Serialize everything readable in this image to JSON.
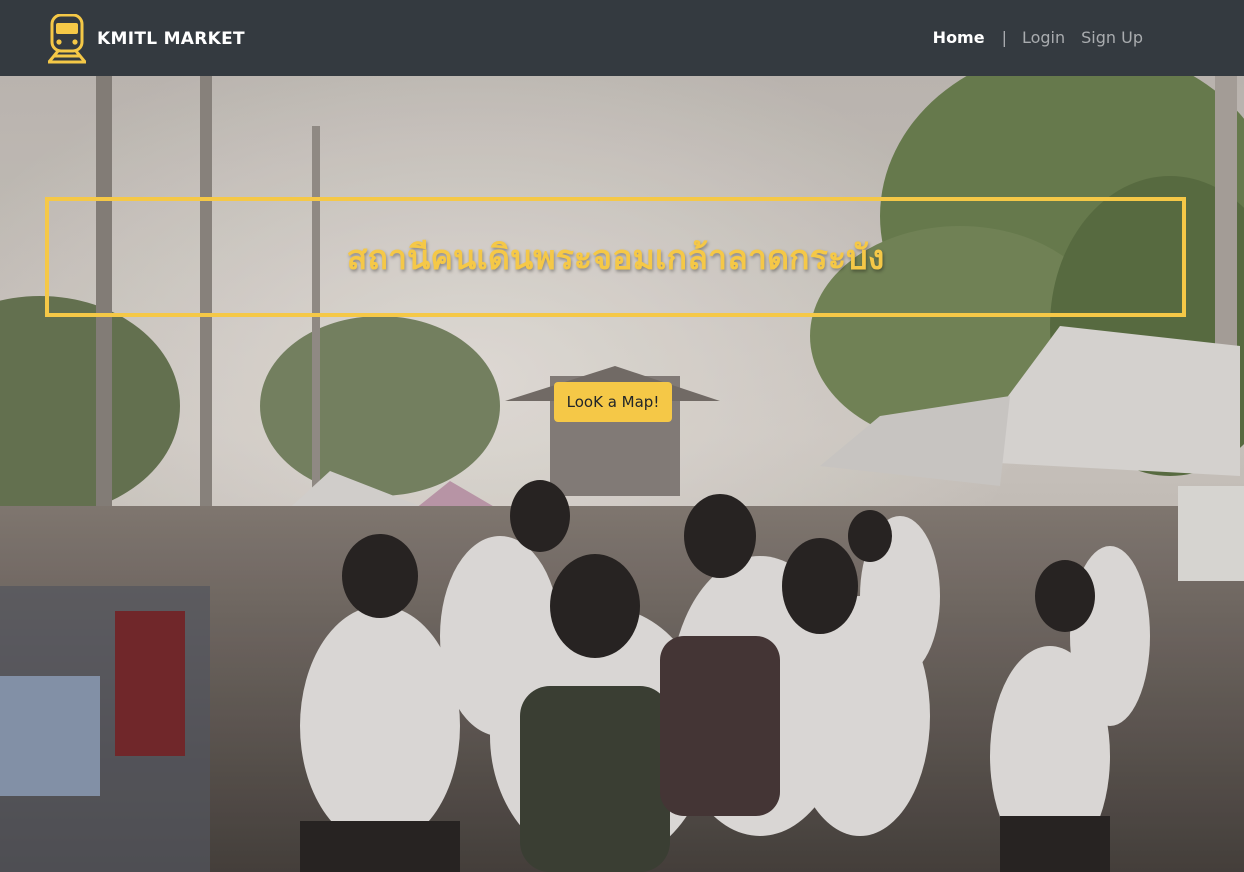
{
  "navbar": {
    "brand": "KMITL MARKET",
    "brand_icon": "train-icon",
    "links": [
      {
        "label": "Home",
        "active": true
      },
      {
        "label": "Login",
        "active": false
      },
      {
        "label": "Sign Up",
        "active": false
      }
    ],
    "separator": "|"
  },
  "hero": {
    "title": "สถานีคนเดินพระจอมเกล้าลาดกระบัง",
    "button_label": "LooK a Map!",
    "background": "walking-street-market-photo"
  },
  "colors": {
    "navbar_bg": "#343a40",
    "accent_yellow": "#f5c847",
    "nav_active": "#ffffff",
    "nav_inactive": "#a9acaf"
  }
}
